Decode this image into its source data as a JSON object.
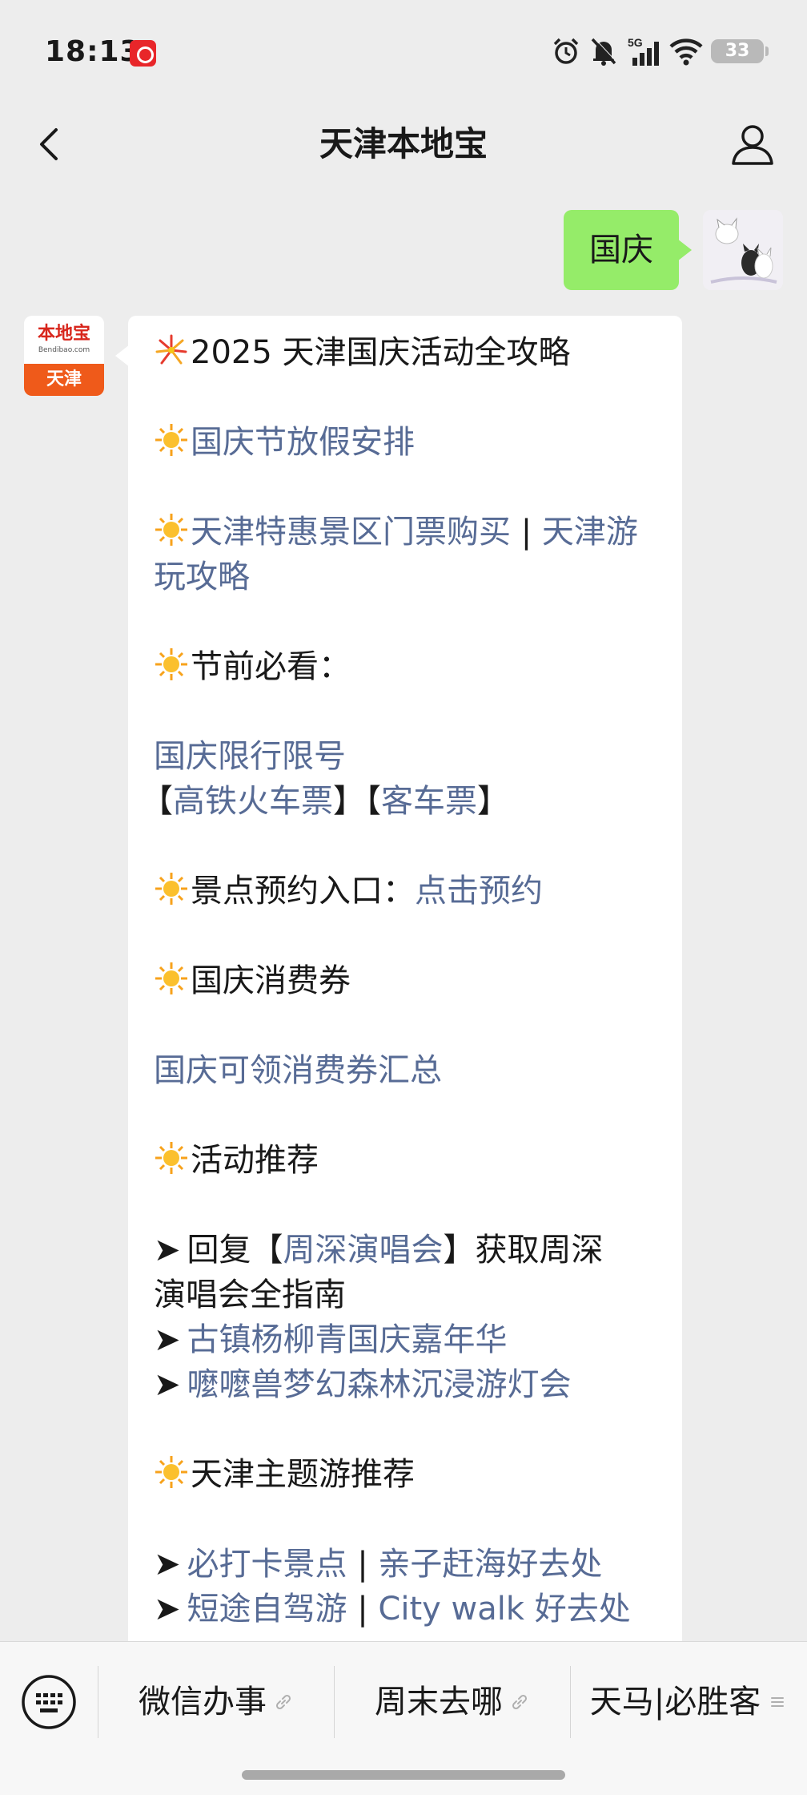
{
  "status_bar": {
    "time": "18:13",
    "network": "5G",
    "battery": "33"
  },
  "header": {
    "title": "天津本地宝"
  },
  "chat": {
    "my_message": "国庆",
    "bot_avatar": {
      "logo_cn": "本地宝",
      "logo_en": "Bendibao.com",
      "city": "天津"
    },
    "bot_message": {
      "title": "2025 天津国庆活动全攻略",
      "holiday_link": "国庆节放假安排",
      "tickets_link": "天津特惠景区门票购买",
      "separator": " | ",
      "travel_link_part1": "天津游",
      "travel_link_part2": "玩攻略",
      "pre_holiday": "节前必看：",
      "traffic_link": "国庆限行限号",
      "bracket_open": "【",
      "bracket_close": "】",
      "train_link": "高铁火车票",
      "bus_link": "客车票",
      "booking_label": "景点预约入口：",
      "booking_link": "点击预约",
      "coupon_heading": "国庆消费券",
      "coupon_link": "国庆可领消费券汇总",
      "events_heading": "活动推荐",
      "arrow": "➤",
      "reply_prefix": "回复",
      "concert_link": "周深演唱会",
      "reply_suffix_part1": "获取周深",
      "reply_suffix_part2": "演唱会全指南",
      "carnival_link": "古镇杨柳青国庆嘉年华",
      "lantern_link": "嚒嚒兽梦幻森林沉浸游灯会",
      "theme_heading": "天津主题游推荐",
      "spots_link": "必打卡景点",
      "beach_link": "亲子赶海好去处",
      "drive_link": "短途自驾游",
      "citywalk_link": "City walk 好去处"
    }
  },
  "bottom_menu": {
    "item1": "微信办事",
    "item2": "周末去哪",
    "item3": "天马|必胜客"
  },
  "colors": {
    "link": "#576b95",
    "my_bubble": "#95ec69",
    "background": "#ededed"
  }
}
